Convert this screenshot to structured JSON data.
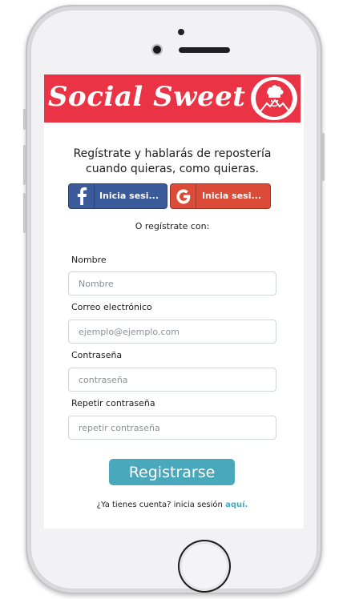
{
  "brand": {
    "title": "Social Sweet",
    "color": "#ea3445"
  },
  "headline": {
    "line1": "Regístrate y hablarás de repostería",
    "line2": "cuando quieras, como quieras."
  },
  "social": {
    "facebook": {
      "label": "Inicia sesi...",
      "color": "#3b5a99",
      "icon": "facebook-icon"
    },
    "google": {
      "label": "Inicia sesi...",
      "color": "#dc4a38",
      "icon": "google-icon"
    }
  },
  "or_text": "O regístrate con:",
  "form": {
    "name": {
      "label": "Nombre",
      "placeholder": "Nombre",
      "value": ""
    },
    "email": {
      "label": "Correo electrónico",
      "placeholder": "ejemplo@ejemplo.com",
      "value": ""
    },
    "password": {
      "label": "Contraseña",
      "placeholder": "contraseña",
      "value": ""
    },
    "repeat_password": {
      "label": "Repetir contraseña",
      "placeholder": "repetir contraseña",
      "value": ""
    },
    "submit_label": "Registrarse",
    "submit_color": "#4aa8bd"
  },
  "login": {
    "prompt": "¿Ya tienes cuenta? inicia sesión",
    "link_label": "aquí."
  }
}
